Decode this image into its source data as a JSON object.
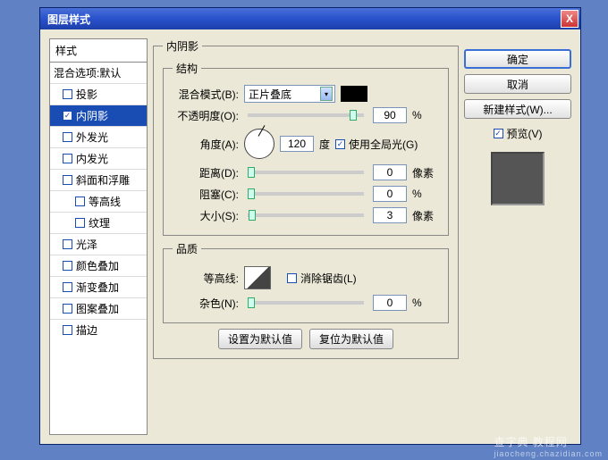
{
  "window": {
    "title": "图层样式",
    "close": "X"
  },
  "left": {
    "header": "样式",
    "items": [
      {
        "label": "混合选项:默认"
      },
      {
        "label": "投影",
        "checkbox": true
      },
      {
        "label": "内阴影",
        "checkbox": true,
        "checked": true,
        "selected": true
      },
      {
        "label": "外发光",
        "checkbox": true
      },
      {
        "label": "内发光",
        "checkbox": true
      },
      {
        "label": "斜面和浮雕",
        "checkbox": true
      },
      {
        "label": "等高线",
        "checkbox": true,
        "indent": 2
      },
      {
        "label": "纹理",
        "checkbox": true,
        "indent": 2
      },
      {
        "label": "光泽",
        "checkbox": true
      },
      {
        "label": "颜色叠加",
        "checkbox": true
      },
      {
        "label": "渐变叠加",
        "checkbox": true
      },
      {
        "label": "图案叠加",
        "checkbox": true
      },
      {
        "label": "描边",
        "checkbox": true
      }
    ]
  },
  "center": {
    "group_title": "内阴影",
    "structure": {
      "legend": "结构",
      "blend_label": "混合模式(B):",
      "blend_value": "正片叠底",
      "color": "#000000",
      "opacity_label": "不透明度(O):",
      "opacity_value": "90",
      "opacity_unit": "%",
      "angle_label": "角度(A):",
      "angle_value": "120",
      "angle_unit": "度",
      "global_light": "使用全局光(G)",
      "global_light_checked": true,
      "distance_label": "距离(D):",
      "distance_value": "0",
      "distance_unit": "像素",
      "choke_label": "阻塞(C):",
      "choke_value": "0",
      "choke_unit": "%",
      "size_label": "大小(S):",
      "size_value": "3",
      "size_unit": "像素"
    },
    "quality": {
      "legend": "品质",
      "contour_label": "等高线:",
      "antialias": "消除锯齿(L)",
      "noise_label": "杂色(N):",
      "noise_value": "0",
      "noise_unit": "%"
    },
    "defaults": {
      "set": "设置为默认值",
      "reset": "复位为默认值"
    }
  },
  "right": {
    "ok": "确定",
    "cancel": "取消",
    "new_style": "新建样式(W)...",
    "preview_label": "预览(V)",
    "preview_checked": true
  },
  "watermark": {
    "t1": "查字典 教程网",
    "t2": "jiaocheng.chazidian.com"
  }
}
